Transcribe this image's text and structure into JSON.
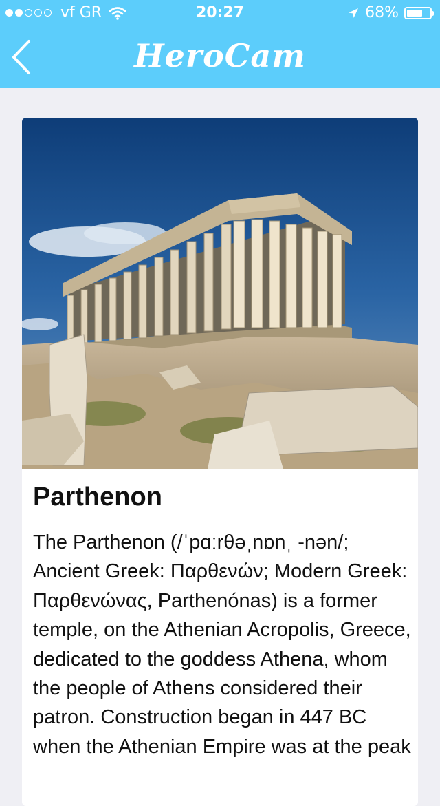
{
  "status_bar": {
    "signal_bars_filled": 2,
    "signal_bars_total": 5,
    "carrier": "vf GR",
    "time": "20:27",
    "battery_text": "68%",
    "battery_level": 0.68
  },
  "nav": {
    "title": "HeroCam",
    "back_icon": "chevron-left-icon"
  },
  "article": {
    "image_alt": "Parthenon",
    "title": "Parthenon",
    "body": "The Parthenon (/ˈpɑːrθəˌnɒnˌ -nən/; Ancient Greek: Παρθενών; Modern Greek: Παρθενώνας, Parthenónas) is a former temple, on the Athenian Acropolis, Greece, dedicated to the goddess Athena, whom the people of Athens considered their patron. Construction began in 447 BC when the Athenian Empire was at the peak"
  },
  "colors": {
    "header_bg": "#5ccdfb",
    "page_bg": "#efeff4",
    "card_bg": "#ffffff"
  }
}
